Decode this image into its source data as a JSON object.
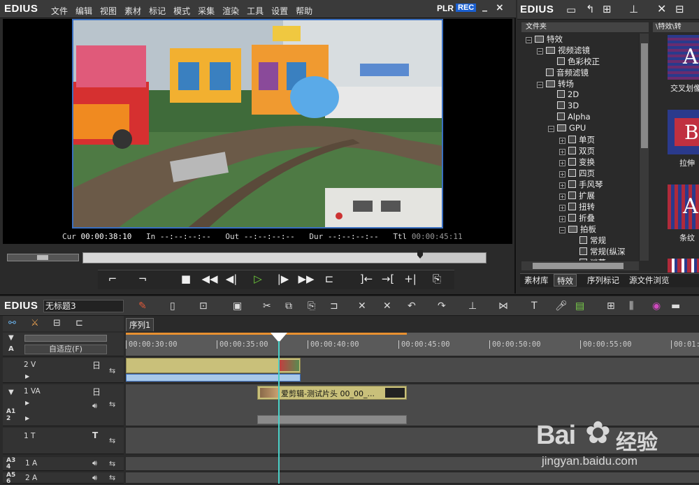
{
  "player": {
    "brand": "EDIUS",
    "menu": [
      "文件",
      "编辑",
      "视图",
      "素材",
      "标记",
      "模式",
      "采集",
      "渲染",
      "工具",
      "设置",
      "帮助"
    ],
    "plr": "PLR",
    "rec": "REC",
    "minimize": "_",
    "close": "×",
    "timecodes": {
      "cur_label": "Cur",
      "cur_value": "00:00:38:10",
      "in_label": "In",
      "in_value": "--:--:--:--",
      "out_label": "Out",
      "out_value": "--:--:--:--",
      "dur_label": "Dur",
      "dur_value": "--:--:--:--",
      "ttl_label": "Ttl",
      "ttl_value": "00:00:45:11"
    }
  },
  "bin": {
    "brand": "EDIUS",
    "folder_header": "文件夹",
    "content_header": "\\特效\\转",
    "tree": [
      {
        "label": "特效",
        "level": 0,
        "type": "folder",
        "exp": "−"
      },
      {
        "label": "视频滤镜",
        "level": 1,
        "type": "folder",
        "exp": "−"
      },
      {
        "label": "色彩校正",
        "level": 2,
        "type": "fx",
        "exp": ""
      },
      {
        "label": "音频滤镜",
        "level": 1,
        "type": "fx",
        "exp": ""
      },
      {
        "label": "转场",
        "level": 1,
        "type": "folder",
        "exp": "−"
      },
      {
        "label": "2D",
        "level": 2,
        "type": "fx",
        "exp": ""
      },
      {
        "label": "3D",
        "level": 2,
        "type": "fx",
        "exp": ""
      },
      {
        "label": "Alpha",
        "level": 2,
        "type": "fx",
        "exp": ""
      },
      {
        "label": "GPU",
        "level": 2,
        "type": "folder",
        "exp": "−"
      },
      {
        "label": "单页",
        "level": 3,
        "type": "fx",
        "exp": "+"
      },
      {
        "label": "双页",
        "level": 3,
        "type": "fx",
        "exp": "+"
      },
      {
        "label": "变换",
        "level": 3,
        "type": "fx",
        "exp": "+"
      },
      {
        "label": "四页",
        "level": 3,
        "type": "fx",
        "exp": "+"
      },
      {
        "label": "手风琴",
        "level": 3,
        "type": "fx",
        "exp": "+"
      },
      {
        "label": "扩展",
        "level": 3,
        "type": "fx",
        "exp": "+"
      },
      {
        "label": "扭转",
        "level": 3,
        "type": "fx",
        "exp": "+"
      },
      {
        "label": "折叠",
        "level": 3,
        "type": "fx",
        "exp": "+"
      },
      {
        "label": "拍板",
        "level": 3,
        "type": "folder",
        "exp": "−"
      },
      {
        "label": "常规",
        "level": 4,
        "type": "fx",
        "exp": ""
      },
      {
        "label": "常规(纵深",
        "level": 4,
        "type": "fx",
        "exp": ""
      },
      {
        "label": "谜幕",
        "level": 4,
        "type": "fx",
        "exp": ""
      }
    ],
    "thumbs": [
      "交叉划像",
      "拉伸",
      "条纹"
    ],
    "tabs": [
      "素材库",
      "特效",
      "序列标记",
      "源文件浏览"
    ],
    "active_tab": "特效"
  },
  "timeline": {
    "brand": "EDIUS",
    "project_name": "无标题3",
    "sequence_tab": "序列1",
    "fit_label": "自适应(F)",
    "ruler": [
      "00:00:30:00",
      "00:00:35:00",
      "00:00:40:00",
      "00:00:45:00",
      "00:00:50:00",
      "00:00:55:00",
      "00:01:"
    ],
    "tracks": [
      {
        "name": "2 V"
      },
      {
        "name": "1 VA"
      },
      {
        "name": "1 T"
      },
      {
        "name": "1 A"
      },
      {
        "name": "2 A"
      }
    ],
    "clip_title": "爱剪辑-测试片头 00_00_...",
    "a12": "A1 2",
    "a34": "A3 4",
    "a56": "A5 6"
  },
  "watermark": {
    "logo_text": "Bai",
    "logo_text2": "经验",
    "url": "jingyan.baidu.com"
  },
  "colors": {
    "accent_play": "#6fcf3a",
    "rec_bg": "#1a5fd0",
    "clip_yellow": "#c9c07a",
    "playhead": "#4ad0c8"
  }
}
